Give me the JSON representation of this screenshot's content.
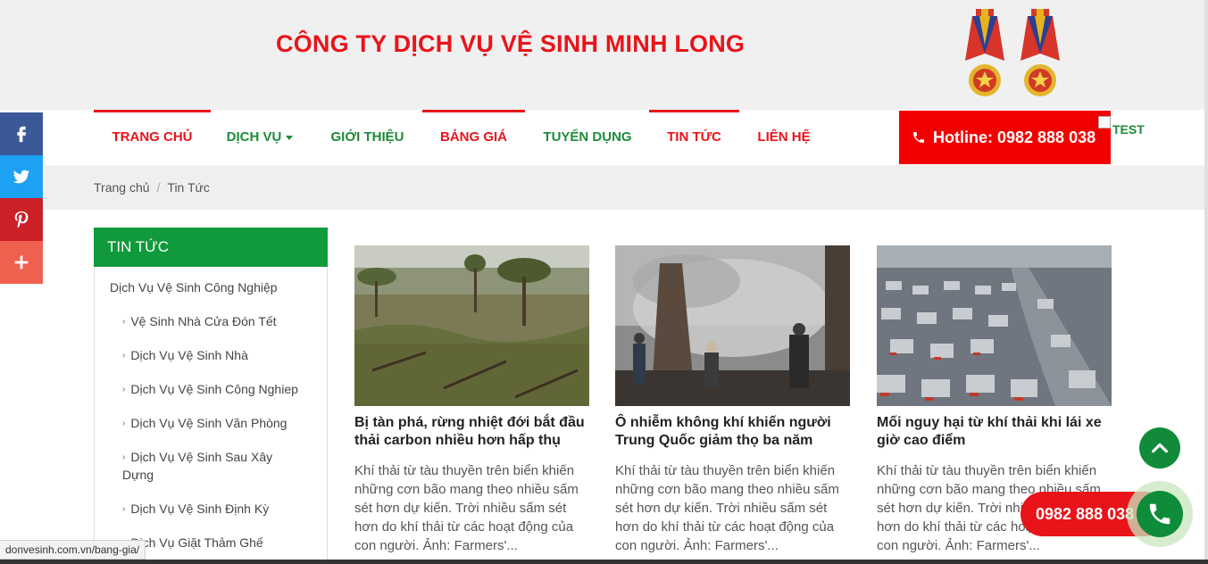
{
  "header": {
    "company_name": "CÔNG TY DỊCH VỤ VỆ SINH MINH LONG"
  },
  "nav": {
    "items": [
      {
        "label": "TRANG CHỦ"
      },
      {
        "label": "DỊCH VỤ"
      },
      {
        "label": "GIỚI THIỆU"
      },
      {
        "label": "BẢNG GIÁ"
      },
      {
        "label": "TUYỂN DỤNG"
      },
      {
        "label": "TIN TỨC"
      },
      {
        "label": "LIÊN HỆ"
      }
    ],
    "hotline_label": "Hotline: 0982 888 038",
    "test_label": "TEST"
  },
  "breadcrumb": {
    "home": "Trang chủ",
    "separator": "/",
    "current": "Tin Tức"
  },
  "sidebar": {
    "heading": "TIN TỨC",
    "items": [
      {
        "label": "Dịch Vụ Vệ Sinh Công Nghiệp"
      },
      {
        "label": "Vệ Sinh Nhà Cửa Đón Tết"
      },
      {
        "label": "Dịch Vụ Vệ Sinh Nhà"
      },
      {
        "label": "Dịch Vụ Vệ Sinh Công Nghiep"
      },
      {
        "label": "Dịch Vụ Vệ Sinh Văn Phòng"
      },
      {
        "label": "Dịch Vụ Vệ Sinh Sau Xây"
      },
      {
        "label": "Dựng"
      },
      {
        "label": "Dịch Vụ Vệ Sinh Định Kỳ"
      },
      {
        "label": "Dịch Vụ Giặt Thảm Ghế"
      }
    ]
  },
  "articles": [
    {
      "title": "Bị tàn phá, rừng nhiệt đới bắt đầu thải carbon nhiều hơn hấp thụ",
      "excerpt": "Khí thải từ tàu thuyền trên biển khiến những cơn bão mang theo nhiều sấm sét hơn dự kiến.   Trời nhiều sấm sét hơn do khí thải từ các hoạt động của con người. Ảnh: Farmers'..."
    },
    {
      "title": "Ô nhiễm không khí khiến người Trung Quốc giảm thọ ba năm",
      "excerpt": "Khí thải từ tàu thuyền trên biển khiến những cơn bão mang theo nhiều sấm sét hơn dự kiến.   Trời nhiều sấm sét hơn do khí thải từ các hoạt động của con người. Ảnh: Farmers'..."
    },
    {
      "title": "Mối nguy hại từ khí thải khi lái xe giờ cao điểm",
      "excerpt": "Khí thải từ tàu thuyền trên biển khiến những cơn bão mang theo nhiều sấm sét hơn dự kiến.   Trời nhiều sấm sét hơn do khí thải từ các hoạt động của con người. Ảnh: Farmers'..."
    }
  ],
  "call_widget": {
    "phone": "0982 888 038"
  },
  "status_bar": {
    "url": "donvesinh.com.vn/bang-gia/"
  },
  "colors": {
    "brand_red": "#e8141a",
    "brand_green": "#109a3c",
    "facebook": "#3b5998",
    "twitter": "#1da1f2",
    "pinterest": "#cb2027",
    "share": "#f0604f"
  }
}
